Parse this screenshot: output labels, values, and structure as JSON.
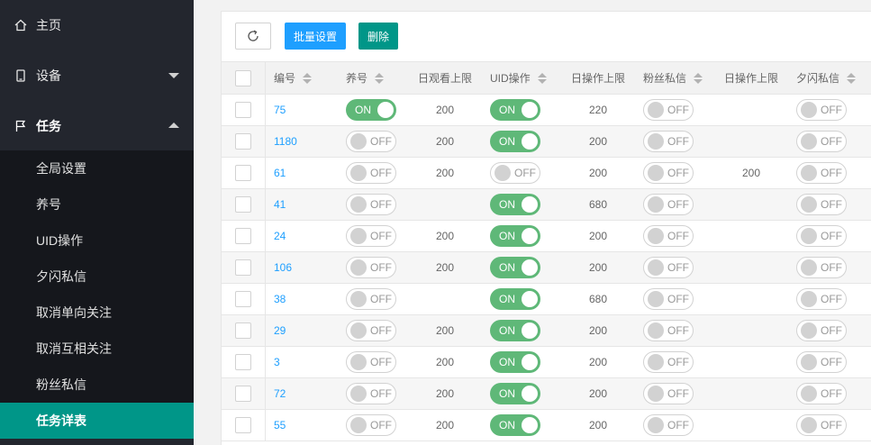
{
  "sidebar": {
    "home": "主页",
    "device": "设备",
    "task": "任务",
    "submenu": [
      "全局设置",
      "养号",
      "UID操作",
      "夕闪私信",
      "取消单向关注",
      "取消互相关注",
      "粉丝私信",
      "任务详表"
    ]
  },
  "toolbar": {
    "batch_label": "批量设置",
    "delete_label": "删除"
  },
  "table": {
    "headers": [
      "编号",
      "养号",
      "日观看上限",
      "UID操作",
      "日操作上限",
      "粉丝私信",
      "日操作上限",
      "夕闪私信"
    ],
    "on_label": "ON",
    "off_label": "OFF",
    "rows": [
      {
        "id": "75",
        "yang": "ON",
        "watch": "200",
        "uid": "ON",
        "dayop": "220",
        "fans": "OFF",
        "dayop2": "",
        "xi": "OFF"
      },
      {
        "id": "1180",
        "yang": "OFF",
        "watch": "200",
        "uid": "ON",
        "dayop": "200",
        "fans": "OFF",
        "dayop2": "",
        "xi": "OFF"
      },
      {
        "id": "61",
        "yang": "OFF",
        "watch": "200",
        "uid": "OFF",
        "dayop": "200",
        "fans": "OFF",
        "dayop2": "200",
        "xi": "OFF"
      },
      {
        "id": "41",
        "yang": "OFF",
        "watch": "",
        "uid": "ON",
        "dayop": "680",
        "fans": "OFF",
        "dayop2": "",
        "xi": "OFF"
      },
      {
        "id": "24",
        "yang": "OFF",
        "watch": "200",
        "uid": "ON",
        "dayop": "200",
        "fans": "OFF",
        "dayop2": "",
        "xi": "OFF"
      },
      {
        "id": "106",
        "yang": "OFF",
        "watch": "200",
        "uid": "ON",
        "dayop": "200",
        "fans": "OFF",
        "dayop2": "",
        "xi": "OFF"
      },
      {
        "id": "38",
        "yang": "OFF",
        "watch": "",
        "uid": "ON",
        "dayop": "680",
        "fans": "OFF",
        "dayop2": "",
        "xi": "OFF"
      },
      {
        "id": "29",
        "yang": "OFF",
        "watch": "200",
        "uid": "ON",
        "dayop": "200",
        "fans": "OFF",
        "dayop2": "",
        "xi": "OFF"
      },
      {
        "id": "3",
        "yang": "OFF",
        "watch": "200",
        "uid": "ON",
        "dayop": "200",
        "fans": "OFF",
        "dayop2": "",
        "xi": "OFF"
      },
      {
        "id": "72",
        "yang": "OFF",
        "watch": "200",
        "uid": "ON",
        "dayop": "200",
        "fans": "OFF",
        "dayop2": "",
        "xi": "OFF"
      },
      {
        "id": "55",
        "yang": "OFF",
        "watch": "200",
        "uid": "ON",
        "dayop": "200",
        "fans": "OFF",
        "dayop2": "",
        "xi": "OFF"
      }
    ]
  },
  "colors": {
    "sidebar": "#23262e",
    "active": "#009688",
    "switch_on": "#5fb878",
    "link": "#1e9fff"
  }
}
